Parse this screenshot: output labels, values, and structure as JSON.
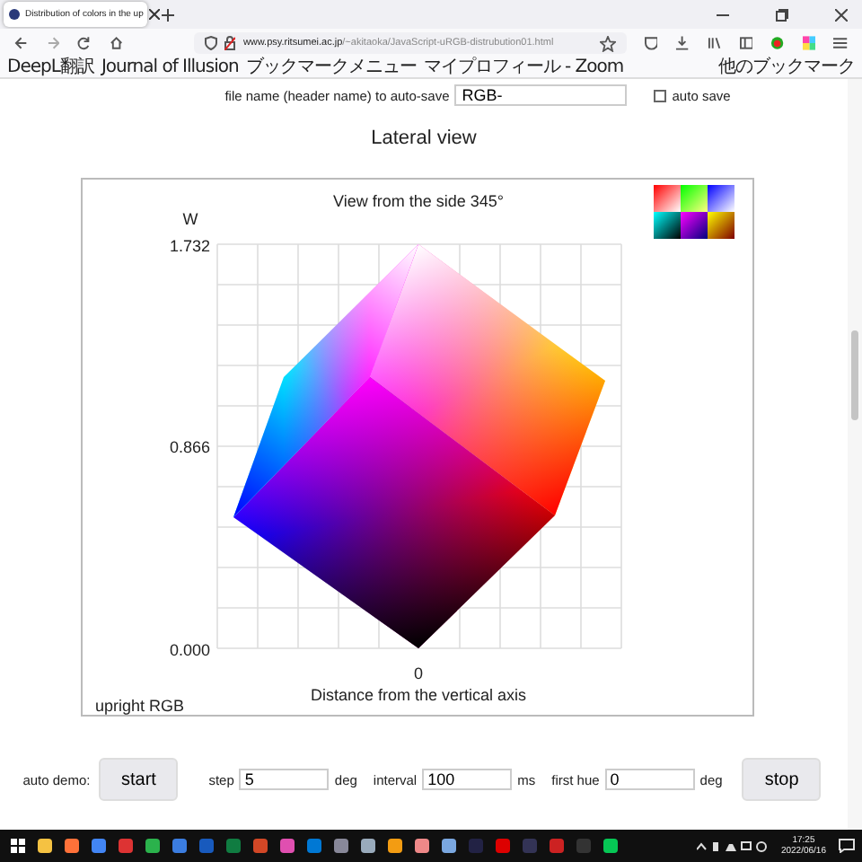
{
  "browser": {
    "tab_title": "Distribution of colors in the up",
    "url_host": "www.psy.ritsumei.ac.jp",
    "url_path": "/~akitaoka/JavaScript-uRGB-distrubution01.html",
    "bookmarks": [
      "DeepL翻訳",
      "Journal of Illusion",
      "ブックマークメニュー",
      "マイプロフィール - Zoom"
    ],
    "other_bookmarks": "他のブックマーク"
  },
  "autosave": {
    "label": "file name (header name) to auto-save",
    "value": "RGB-",
    "checkbox_label": "auto save",
    "checked": false
  },
  "heading": "Lateral view",
  "chart": {
    "title": "View from the side 345°",
    "y_label": "W",
    "y_ticks": [
      "1.732",
      "0.866",
      "0.000"
    ],
    "x_tick": "0",
    "x_label": "Distance from the vertical axis",
    "caption": "upright RGB"
  },
  "demo": {
    "label": "auto demo:",
    "start": "start",
    "stop": "stop",
    "fields": [
      {
        "label": "step",
        "value": "5",
        "unit": "deg"
      },
      {
        "label": "interval",
        "value": "100",
        "unit": "ms"
      },
      {
        "label": "first hue",
        "value": "0",
        "unit": "deg"
      }
    ]
  },
  "taskbar": {
    "time": "17:25",
    "date": "2022/06/16"
  }
}
